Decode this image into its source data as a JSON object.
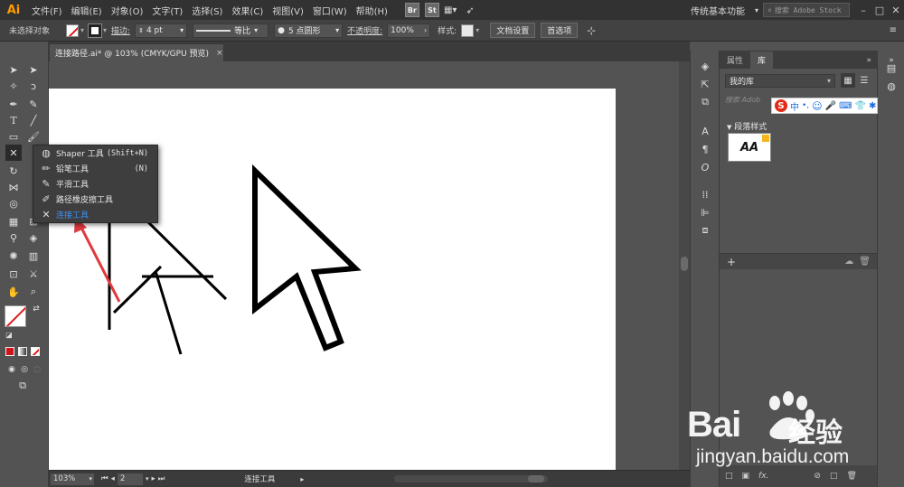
{
  "app": {
    "logo": "Ai"
  },
  "menubar": {
    "items": [
      "文件(F)",
      "编辑(E)",
      "对象(O)",
      "文字(T)",
      "选择(S)",
      "效果(C)",
      "视图(V)",
      "窗口(W)",
      "帮助(H)"
    ],
    "bridge": "Br",
    "stock": "St",
    "workspace": "传统基本功能",
    "stock_search_placeholder": "搜索 Adobe Stock"
  },
  "controlbar": {
    "selection": "未选择对象",
    "stroke_label": "描边:",
    "stroke_weight": "4 pt",
    "stroke_profile": "等比",
    "brush": "5 点圆形",
    "opacity_label": "不透明度:",
    "opacity": "100%",
    "style_label": "样式:",
    "doc_setup": "文档设置",
    "preferences": "首选项"
  },
  "document": {
    "tab_title": "连接路径.ai* @ 103% (CMYK/GPU 预览)",
    "tab_close": "×"
  },
  "flyout": {
    "items": [
      {
        "label": "Shaper 工具",
        "shortcut": "(Shift+N)",
        "icon": "shaper-icon"
      },
      {
        "label": "铅笔工具",
        "shortcut": "(N)",
        "icon": "pencil-icon"
      },
      {
        "label": "平滑工具",
        "shortcut": "",
        "icon": "smooth-icon"
      },
      {
        "label": "路径橡皮擦工具",
        "shortcut": "",
        "icon": "path-eraser-icon"
      },
      {
        "label": "连接工具",
        "shortcut": "",
        "icon": "join-icon"
      }
    ]
  },
  "statusbar": {
    "zoom": "103%",
    "page": "2",
    "mode": "连接工具"
  },
  "libraries": {
    "tabs": [
      "属性",
      "库"
    ],
    "active_tab": "库",
    "more": "»",
    "library_name": "我的库",
    "search_placeholder": "搜索 Adob",
    "section": "段落样式",
    "para_style_sample": "AA",
    "ime_logo": "S",
    "ime_lang": "中"
  },
  "watermark": {
    "brand": "Bai",
    "jy": "经验",
    "url": "jingyan.baidu.com"
  },
  "colors": {
    "accent_highlight": "#3c8ff6",
    "arrow_annotation": "#e0393e",
    "logo_orange": "#ff9a00"
  }
}
